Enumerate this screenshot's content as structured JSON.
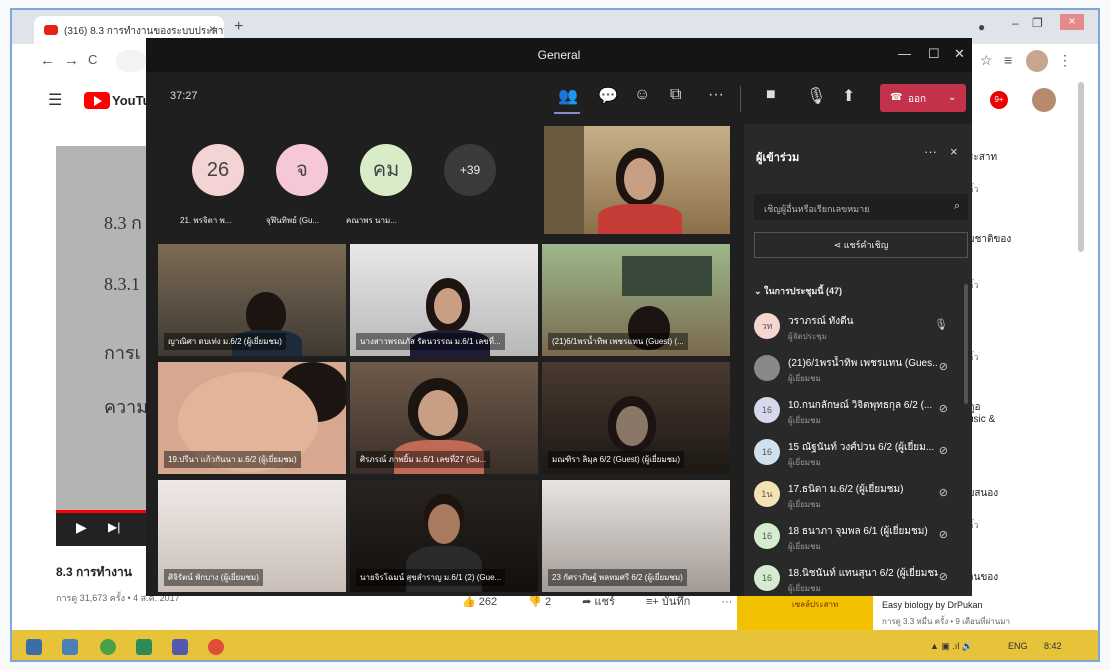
{
  "browser": {
    "tab_title": "(316) 8.3 การทำงานของระบบประสาท",
    "tab_close": "×",
    "new_tab": "+",
    "nav_back": "←",
    "nav_forward": "→",
    "nav_reload": "C"
  },
  "youtube": {
    "logo_text": "YouTube",
    "notification_count": "9+",
    "slide_lines": [
      "8.3 ก",
      "8.3.1",
      "การเ",
      "ความ"
    ],
    "video_title": "8.3 การทำงาน",
    "video_meta": "การดู 31,673 ครั้ง • 4 ส.ค. 2017",
    "like_count": "262",
    "dislike_count": "2",
    "share_label": "แชร์",
    "save_label": "บันทึก",
    "more_label": "···",
    "sidebar_titles": [
      "ระสาท",
      "มชาติของ",
      "ดูอ",
      "usic &",
      "บสนอง",
      "านของ"
    ],
    "sidebar_subs": [
      "ลั้ว",
      "ลั้ว",
      "ลั้ว",
      "ลั้ว",
      "ลั้ว"
    ],
    "rec_title": "Easy biology by DrPukan",
    "rec_meta": "การดู 3.3 หมื่น ครั้ง • 9 เดือนที่ผ่านมา",
    "rec_thumb_text": "เซลล์ประสาท"
  },
  "teams": {
    "window_title": "General",
    "timer": "37:27",
    "leave_label": "ออก",
    "more_icon": "···",
    "circles": [
      {
        "label": "26",
        "name": "21. พรจิดา พ..."
      },
      {
        "label": "จ",
        "name": "จุฬินทิพย์ (Gu..."
      },
      {
        "label": "คม",
        "name": "คณาพร นาม..."
      },
      {
        "label": "+39",
        "name": ""
      }
    ],
    "tiles": [
      "ญาณิศา ดบเท่ง ม.6/2 (ผู้เยี่ยมชม)",
      "นางสาวพรณภัส รัตนวรรณ ม.6/1 เลขที่...",
      "(21)6/1พรน้ำทิพ เพชรแทน (Guest) (...",
      "19.ปรีนา แก้วกันนา ม.6/2 (ผู้เยี่ยมชม)",
      "ศิรภรณ์ ภาพยิ้ม ม.6/1 เลขที่27 (Gu...",
      "มณฑิรา ลิมุล 6/2 (Guest) (ผู้เยี่ยมชม)",
      "ศิจิรัตน์ พักบาง (ผู้เยี่ยมชม)",
      "นายจิรโฉมน์ สุขสำราญ ม.6/1 (2) (Gue...",
      "23 กัศราภิษฐ์ พลทมศรี 6/2 (ผู้เยี่ยมชม)"
    ]
  },
  "panel": {
    "title": "ผู้เข้าร่วม",
    "more": "···",
    "close": "×",
    "search_placeholder": "เชิญผู้อื่นหรือเรียกเลขหมาย",
    "share_invite": "แชร์คำเชิญ",
    "section_label": "ในการประชุมนี้ (47)",
    "participants": [
      {
        "avatar": "วท",
        "name": "วราภรณ์ ทังดีน",
        "role": "ผู้จัดประชุม"
      },
      {
        "avatar": "",
        "name": "(21)6/1พรน้ำทิพ เพชรแทน (Gues...",
        "role": "ผู้เยี่ยมชม"
      },
      {
        "avatar": "16",
        "name": "10.กนกลักษณ์ วิจิตพุทธกุล 6/2 (...",
        "role": "ผู้เยี่ยมชม"
      },
      {
        "avatar": "16",
        "name": "15 ณัฐนันท์ วงศ์ปวน 6/2 (ผู้เยี่ยม...",
        "role": "ผู้เยี่ยมชม"
      },
      {
        "avatar": "1น",
        "name": "17.ธนิดา ม.6/2 (ผู้เยี่ยมชม)",
        "role": "ผู้เยี่ยมชม"
      },
      {
        "avatar": "16",
        "name": "18 ธนาภา จุมพล 6/1 (ผู้เยี่ยมชม)",
        "role": "ผู้เยี่ยมชม"
      },
      {
        "avatar": "16",
        "name": "18.นิชนันท์ แทนสุนา 6/2 (ผู้เยี่ยมชม)",
        "role": "ผู้เยี่ยมชม"
      }
    ]
  },
  "taskbar": {
    "lang": "ENG",
    "time": "8:42"
  }
}
